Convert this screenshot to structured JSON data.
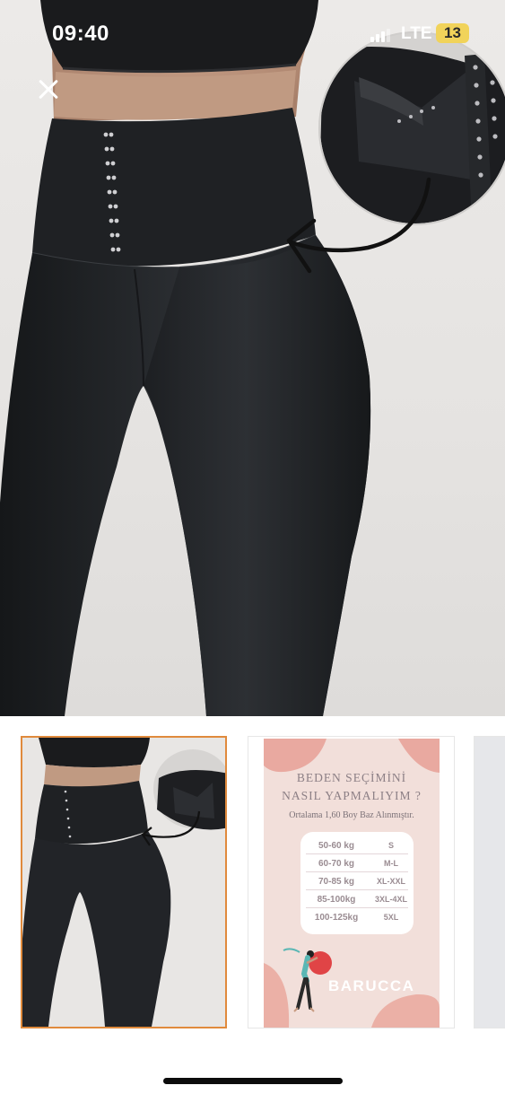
{
  "status_bar": {
    "time": "09:40",
    "network": "LTE",
    "battery": "13"
  },
  "viewer": {
    "close_icon": "close-icon",
    "main_image_icon": "product-photo-leggings"
  },
  "thumbnails": {
    "selected_index": 0,
    "selected_border_color": "#e08a3c",
    "size_chart": {
      "title_line1": "BEDEN SEÇİMİNİ",
      "title_line2": "NASIL YAPMALIYIM ?",
      "subtitle": "Ortalama 1,60 Boy Baz Alınmıştır.",
      "rows": [
        {
          "weight": "50-60 kg",
          "size": "S"
        },
        {
          "weight": "60-70 kg",
          "size": "M-L"
        },
        {
          "weight": "70-85 kg",
          "size": "XL-XXL"
        },
        {
          "weight": "85-100kg",
          "size": "3XL-4XL"
        },
        {
          "weight": "100-125kg",
          "size": "5XL"
        }
      ],
      "brand": "BARUCCA"
    }
  }
}
